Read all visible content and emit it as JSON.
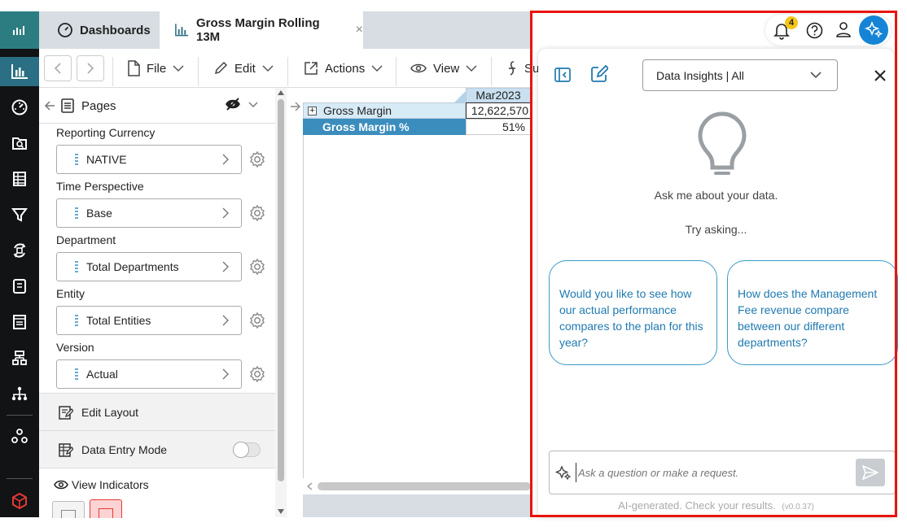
{
  "tabs": {
    "dashboards": "Dashboards",
    "report": "Gross Margin Rolling 13M",
    "close": "×"
  },
  "toolbar": {
    "file": "File",
    "edit": "Edit",
    "actions": "Actions",
    "view": "View",
    "partial": "Su"
  },
  "pages": {
    "title": "Pages",
    "filters": [
      {
        "label": "Reporting Currency",
        "value": "NATIVE"
      },
      {
        "label": "Time Perspective",
        "value": "Base"
      },
      {
        "label": "Department",
        "value": "Total Departments"
      },
      {
        "label": "Entity",
        "value": "Total Entities"
      },
      {
        "label": "Version",
        "value": "Actual"
      }
    ],
    "edit_layout": "Edit Layout",
    "data_entry_mode": "Data Entry Mode",
    "view_indicators": "View Indicators"
  },
  "grid": {
    "column": "Mar2023",
    "rows": [
      {
        "label": "Gross Margin",
        "value": "12,622,570",
        "expand": "+"
      },
      {
        "label": "Gross Margin %",
        "value": "51%"
      }
    ]
  },
  "header_right": {
    "notification_count": "4"
  },
  "ai_panel": {
    "dropdown": "Data Insights | All",
    "prompt": "Ask me about your data.",
    "try": "Try asking...",
    "suggestions": [
      "Would you like to see how our actual performance compares to the plan for this year?",
      "How does the Management Fee revenue compare between our different departments?"
    ],
    "input_placeholder": "Ask a question or make a request.",
    "footer": "AI-generated. Check your results.",
    "version": "(v0.0.37)"
  },
  "colors": {
    "accent": "#1f7ab0",
    "rail": "#111315",
    "rail_logo": "#2c7d82",
    "selected_row": "#3b8dbd",
    "highlight": "#e8140e",
    "badge": "#f5c518"
  }
}
